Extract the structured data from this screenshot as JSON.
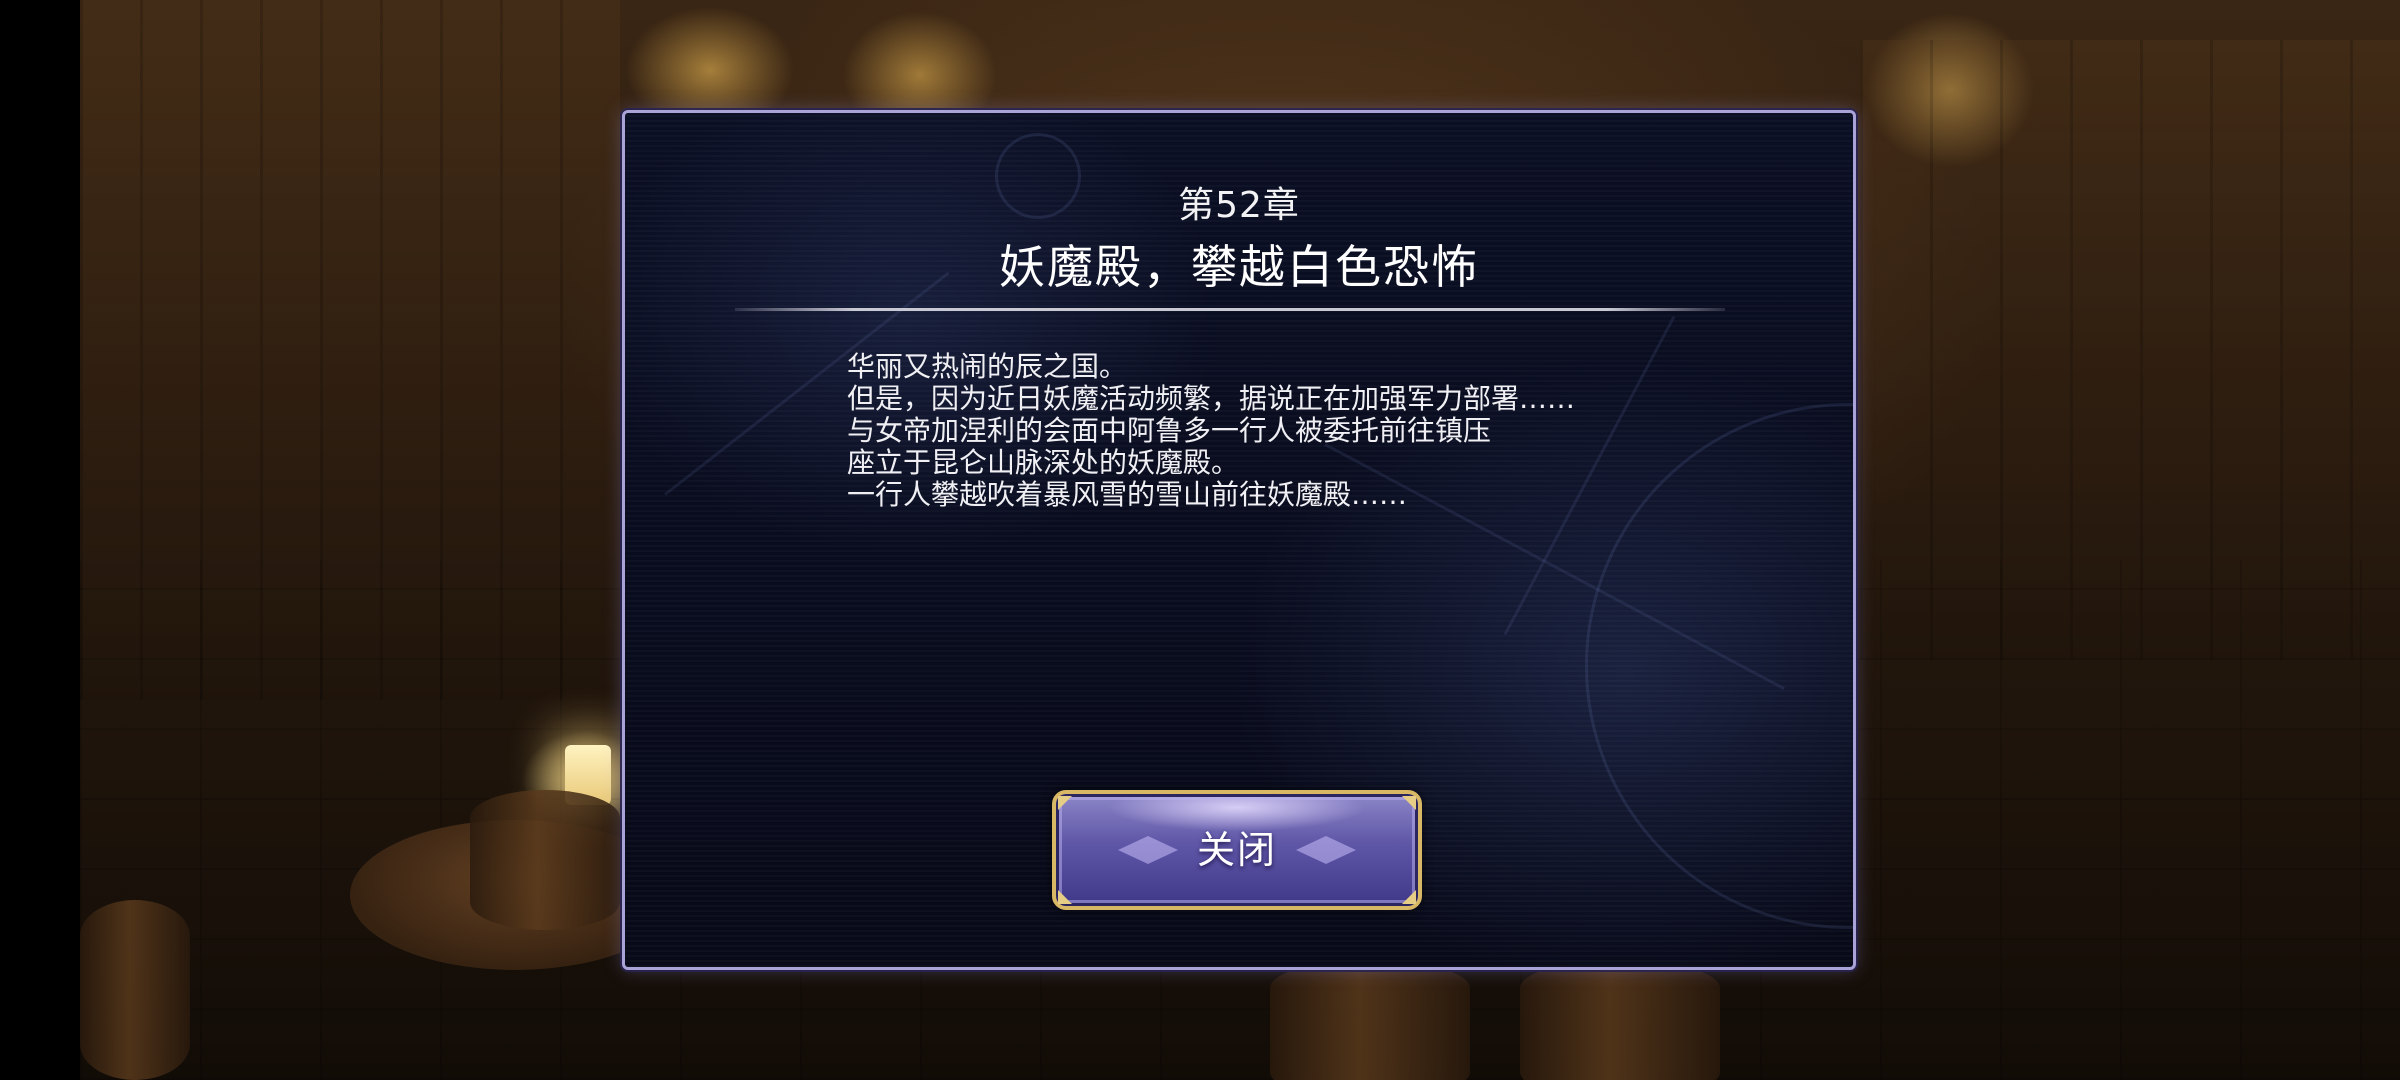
{
  "dialog": {
    "chapter_label": "第52章",
    "chapter_title": "妖魔殿，攀越白色恐怖",
    "story_lines": [
      "华丽又热闹的辰之国。",
      "但是，因为近日妖魔活动频繁，据说正在加强军力部署……",
      "与女帝加涅利的会面中阿鲁多一行人被委托前往镇压",
      "座立于昆仑山脉深处的妖魔殿。",
      "一行人攀越吹着暴风雪的雪山前往妖魔殿……"
    ],
    "close_label": "关闭"
  },
  "colors": {
    "dialog_border": "#a9a3d8",
    "dialog_background": "#0a0e22",
    "button_gold": "#d9b865",
    "button_purple": "#5e56a6"
  }
}
